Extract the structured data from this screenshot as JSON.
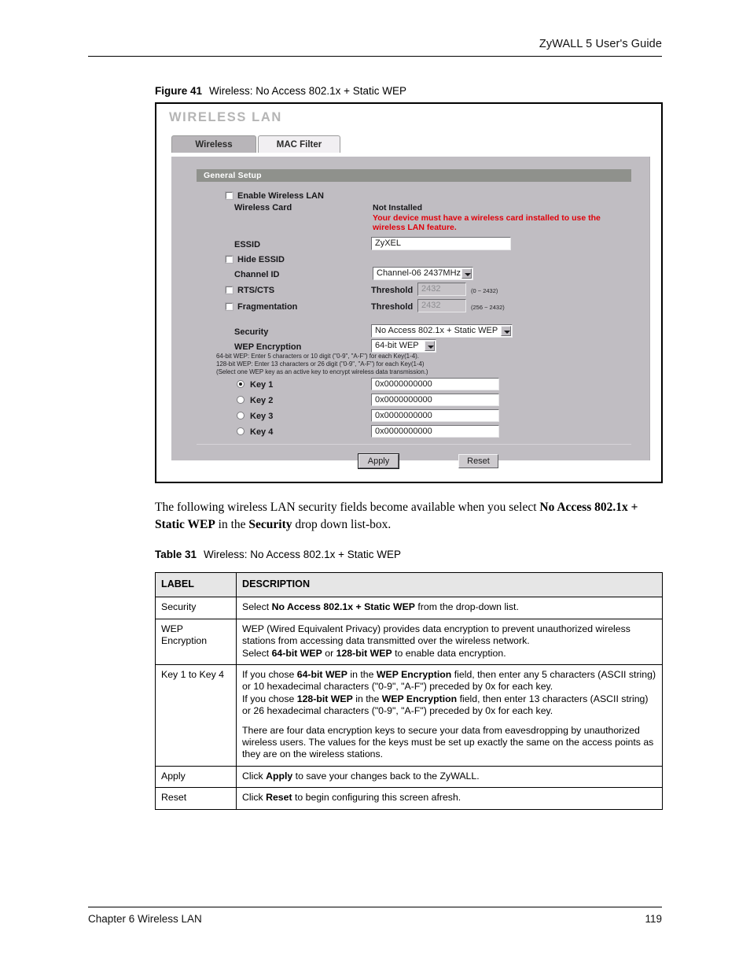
{
  "header": {
    "guide_title": "ZyWALL 5 User's Guide"
  },
  "figure": {
    "number": "Figure 41",
    "title": "Wireless: No Access 802.1x + Static WEP"
  },
  "screenshot": {
    "title": "WIRELESS LAN",
    "tabs": [
      {
        "label": "Wireless",
        "active": true
      },
      {
        "label": "MAC Filter",
        "active": false
      }
    ],
    "section_title": "General Setup",
    "enable_wireless_lan_label": "Enable Wireless LAN",
    "wireless_card_label": "Wireless Card",
    "wireless_card_status": "Not Installed",
    "wireless_card_warning_line1": "Your device must have a wireless card installed to use the",
    "wireless_card_warning_line2": "wireless LAN feature.",
    "warning_color": "#e0000a",
    "essid_label": "ESSID",
    "essid_value": "ZyXEL",
    "hide_essid_label": "Hide ESSID",
    "channel_id_label": "Channel ID",
    "channel_id_value": "Channel-06 2437MHz",
    "rts_cts_label": "RTS/CTS",
    "rts_threshold_label": "Threshold",
    "rts_threshold_value": "2432",
    "rts_range": "(0 ~ 2432)",
    "fragmentation_label": "Fragmentation",
    "frag_threshold_label": "Threshold",
    "frag_threshold_value": "2432",
    "frag_range": "(256 ~ 2432)",
    "security_label": "Security",
    "security_value": "No Access 802.1x + Static WEP",
    "wep_encryption_label": "WEP Encryption",
    "wep_encryption_value": "64-bit WEP",
    "wep_help_line1": "64-bit WEP: Enter 5 characters or 10 digit (\"0-9\", \"A-F\") for each Key(1-4).",
    "wep_help_line2": "128-bit WEP: Enter 13 characters or 26 digit (\"0-9\", \"A-F\") for each Key(1-4)",
    "wep_help_line3": "(Select one WEP key as an active key to encrypt wireless data transmission.)",
    "keys": [
      {
        "label": "Key 1",
        "value": "0x0000000000",
        "selected": true
      },
      {
        "label": "Key 2",
        "value": "0x0000000000",
        "selected": false
      },
      {
        "label": "Key 3",
        "value": "0x0000000000",
        "selected": false
      },
      {
        "label": "Key 4",
        "value": "0x0000000000",
        "selected": false
      }
    ],
    "apply_button": "Apply",
    "reset_button": "Reset"
  },
  "paragraph": {
    "part1": "The following wireless LAN security fields become available when you select ",
    "bold1": "No Access 802.1x + Static WEP",
    "part2": " in the ",
    "bold2": "Security",
    "part3": " drop down list-box."
  },
  "table_caption": {
    "number": "Table 31",
    "title": "Wireless: No Access 802.1x + Static WEP"
  },
  "table": {
    "headers": [
      "LABEL",
      "DESCRIPTION"
    ],
    "rows": [
      {
        "label": "Security",
        "desc_html": "Select <b>No Access 802.1x + Static WEP</b> from the drop-down list."
      },
      {
        "label": "WEP Encryption",
        "desc_html": "WEP (Wired Equivalent Privacy) provides data encryption to prevent unauthorized wireless stations from accessing data transmitted over the wireless network.<br>Select <b>64-bit WEP</b> or <b>128-bit WEP</b> to enable data encryption."
      },
      {
        "label": "Key 1 to Key 4",
        "desc_html": "<p>If you chose <b>64-bit WEP</b> in the <b>WEP Encryption</b> field, then enter any 5 characters (ASCII string) or 10 hexadecimal characters (\"0-9\", \"A-F\") preceded by 0x for each key.<br>If you chose <b>128-bit WEP</b> in the <b>WEP Encryption</b> field, then enter 13 characters (ASCII string) or 26 hexadecimal characters (\"0-9\", \"A-F\") preceded by 0x for each key.</p><p class=\"gap\">There are four data encryption keys to secure your data from eavesdropping by unauthorized wireless users. The values for the keys must be set up exactly the same on the access points as they are on the wireless stations.</p>"
      },
      {
        "label": "Apply",
        "desc_html": "Click <b>Apply</b> to save your changes back to the ZyWALL."
      },
      {
        "label": "Reset",
        "desc_html": "Click <b>Reset</b> to begin configuring this screen afresh."
      }
    ]
  },
  "footer": {
    "chapter": "Chapter 6 Wireless LAN",
    "page": "119"
  }
}
